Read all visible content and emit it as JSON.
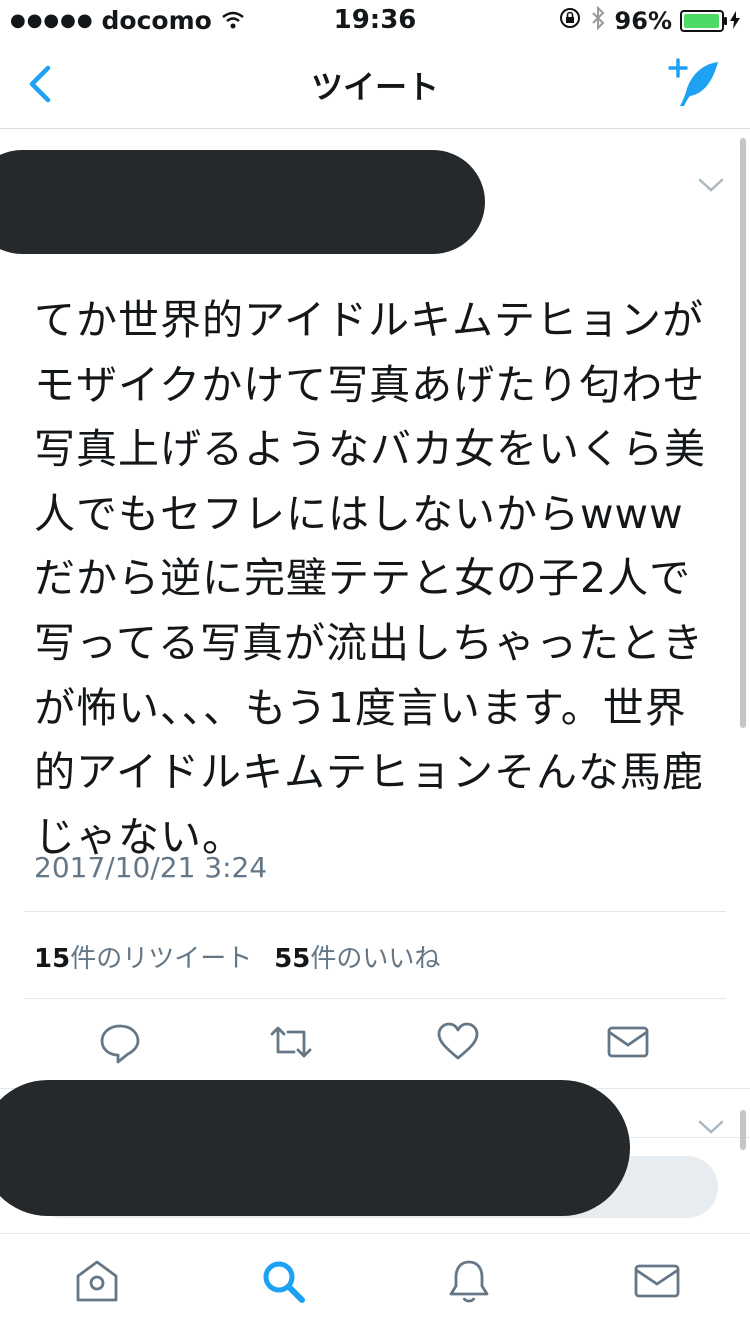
{
  "status_bar": {
    "signal": "●●●●●",
    "carrier": "docomo",
    "time": "19:36",
    "battery_percent": "96%",
    "battery_level": 0.96
  },
  "nav": {
    "title": "ツイート"
  },
  "tweet": {
    "text": "てか世界的アイドルキムテヒョンがモザイクかけて写真あげたり匂わせ写真上げるようなバカ女をいくら美人でもセフレにはしないからwwwだから逆に完璧テテと女の子2人で写ってる写真が流出しちゃったときが怖い、、、もう1度言います。世界的アイドルキムテヒョンそんな馬鹿じゃない。",
    "timestamp": "2017/10/21 3:24",
    "retweet_count": "15",
    "retweet_label": "件のリツイート",
    "like_count": "55",
    "like_label": "件のいいね"
  },
  "colors": {
    "accent": "#1da1f2",
    "muted": "#657786",
    "redaction": "#25292c"
  },
  "icons": {
    "back": "chevron-left-icon",
    "compose": "compose-tweet-icon",
    "reply": "reply-icon",
    "retweet": "retweet-icon",
    "like": "heart-icon",
    "dm": "envelope-icon",
    "home": "home-icon",
    "search": "search-icon",
    "notifications": "bell-icon",
    "messages": "envelope-icon"
  }
}
